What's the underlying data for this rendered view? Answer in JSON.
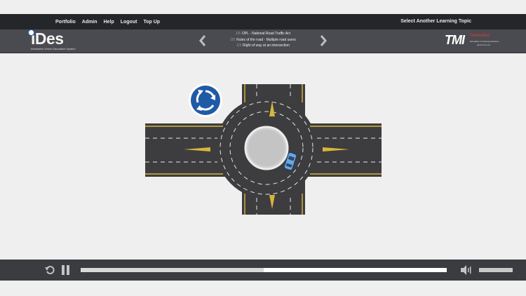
{
  "topbar": {
    "nav": [
      "Portfolio",
      "Admin",
      "Help",
      "Logout",
      "Top Up"
    ],
    "select_topic": "Select Another Learning Topic"
  },
  "header": {
    "logo": {
      "word": "iDes",
      "tagline": "Interactive Driver Education System"
    },
    "breadcrumb": [
      {
        "code": "1/5",
        "text": "OPL - National Road Traffic Act"
      },
      {
        "code": "1/5",
        "text": "Rules of the road - Multiple road users"
      },
      {
        "code": "1/3",
        "text": "Right of way at an intersection"
      }
    ],
    "tmi": {
      "mark": "TMI",
      "brand": "Telematics",
      "subtitle": "Simulation & Training Solutions",
      "url": "www.tmi.co.za"
    }
  },
  "player": {
    "progress_fraction": 0.5,
    "buffered_fraction": 1.0,
    "volume_fraction": 1.0
  },
  "colors": {
    "topbar": "#252629",
    "header": "#4a4b50",
    "controls": "#3b3c40",
    "asphalt": "#3d3d40",
    "road_line": "#d8b53a",
    "sign_blue": "#1f5aa6"
  },
  "icons": {
    "prev": "chevron-left-icon",
    "next": "chevron-right-icon",
    "replay": "replay-icon",
    "pause": "pause-icon",
    "volume": "speaker-icon",
    "roundabout_sign": "roundabout-sign-icon"
  }
}
